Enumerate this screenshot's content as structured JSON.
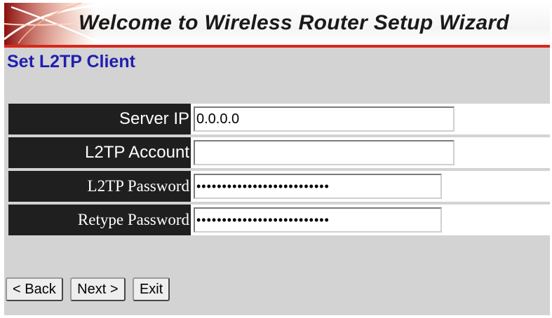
{
  "banner": {
    "title": "Welcome to Wireless Router Setup Wizard"
  },
  "page": {
    "title": "Set L2TP Client"
  },
  "form": {
    "fields": [
      {
        "label": "Server IP",
        "value": "0.0.0.0",
        "type": "text"
      },
      {
        "label": "L2TP Account",
        "value": "",
        "type": "text"
      },
      {
        "label": "L2TP Password",
        "value": "••••••••••••••••••••••••••",
        "type": "password"
      },
      {
        "label": "Retype Password",
        "value": "••••••••••••••••••••••••••",
        "type": "password"
      }
    ]
  },
  "buttons": {
    "back": "< Back",
    "next": "Next >",
    "exit": "Exit"
  },
  "colors": {
    "title_blue": "#1f1fb0",
    "banner_accent": "#d7281c",
    "label_bg": "#1f1f1f",
    "panel_bg": "#d3d3d3"
  }
}
